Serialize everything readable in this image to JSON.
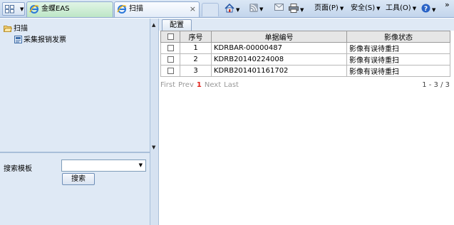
{
  "browser": {
    "tabs": [
      {
        "label": "金蝶EAS"
      },
      {
        "label": "扫描",
        "close": "×"
      }
    ],
    "commands": {
      "page": "页面(P)",
      "safety": "安全(S)",
      "tools": "工具(O)",
      "overflow": "»"
    }
  },
  "tree": {
    "root": "扫描",
    "child": "采集报销发票"
  },
  "search": {
    "label": "搜索模板",
    "select_value": "",
    "button": "搜索"
  },
  "toolbar": {
    "config": "配置"
  },
  "table": {
    "headers": [
      "序号",
      "单据编号",
      "影像状态"
    ],
    "rows": [
      {
        "seq": "1",
        "code": "KDRBAR-00000487",
        "status": "影像有误待重扫"
      },
      {
        "seq": "2",
        "code": "KDRB20140224008",
        "status": "影像有误待重扫"
      },
      {
        "seq": "3",
        "code": "KDRB201401161702",
        "status": "影像有误待重扫"
      }
    ]
  },
  "pager": {
    "first": "First",
    "prev": "Prev",
    "current": "1",
    "next": "Next",
    "last": "Last",
    "info": "1 - 3 / 3"
  },
  "colors": {
    "accent_red": "#e0221b",
    "pane_bg": "#dfe9f5",
    "eas_tab_bg": "#bde6c6"
  }
}
